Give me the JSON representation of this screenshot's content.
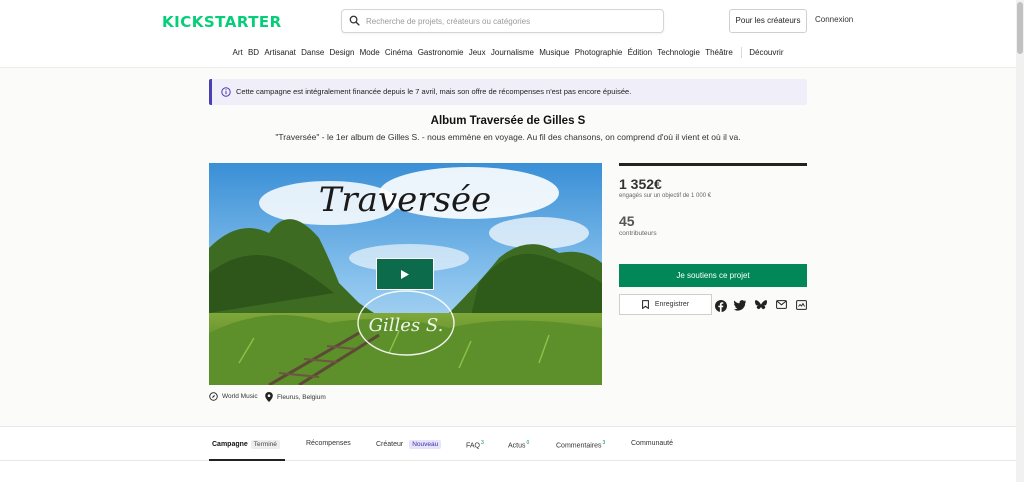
{
  "header": {
    "logo": "KICKSTARTER",
    "search_placeholder": "Recherche de projets, créateurs ou catégories",
    "creators_button": "Pour les créateurs",
    "login": "Connexion"
  },
  "categories": [
    "Art",
    "BD",
    "Artisanat",
    "Danse",
    "Design",
    "Mode",
    "Cinéma",
    "Gastronomie",
    "Jeux",
    "Journalisme",
    "Musique",
    "Photographie",
    "Édition",
    "Technologie",
    "Théâtre"
  ],
  "discover": "Découvrir",
  "notice": "Cette campagne est intégralement financée depuis le 7 avril, mais son offre de récompenses n'est pas encore épuisée.",
  "project": {
    "title": "Album Traversée de Gilles S",
    "subtitle": "\"Traversée\" - le 1er album de Gilles S. - nous emmène en voyage. Au fil des chansons, on comprend d'où il vient et où il va.",
    "video_title": "Traversée",
    "video_signature": "Gilles S.",
    "category": "World Music",
    "location": "Fleurus, Belgium",
    "progress_fraction": 1.0
  },
  "stats": {
    "amount": "1 352€",
    "goal": "engagés sur un objectif de 1 000 €",
    "backers": "45",
    "backers_label": "contributeurs"
  },
  "actions": {
    "back": "Je soutiens ce projet",
    "save": "Enregistrer"
  },
  "share_icons": [
    "facebook-icon",
    "twitter-icon",
    "bluesky-icon",
    "email-icon",
    "embed-icon"
  ],
  "tabs": [
    {
      "label": "Campagne",
      "badge": "Terminé"
    },
    {
      "label": "Récompenses"
    },
    {
      "label": "Créateur",
      "badge": "Nouveau"
    },
    {
      "label": "FAQ",
      "count": "3"
    },
    {
      "label": "Actus",
      "count": "0"
    },
    {
      "label": "Commentaires",
      "count": "3"
    },
    {
      "label": "Communauté"
    }
  ],
  "colors": {
    "brand": "#05ce78",
    "primary_button": "#028858",
    "notice_bg": "#efeef9",
    "notice_accent": "#4b3fb0",
    "play_button": "#0b6b4a"
  }
}
